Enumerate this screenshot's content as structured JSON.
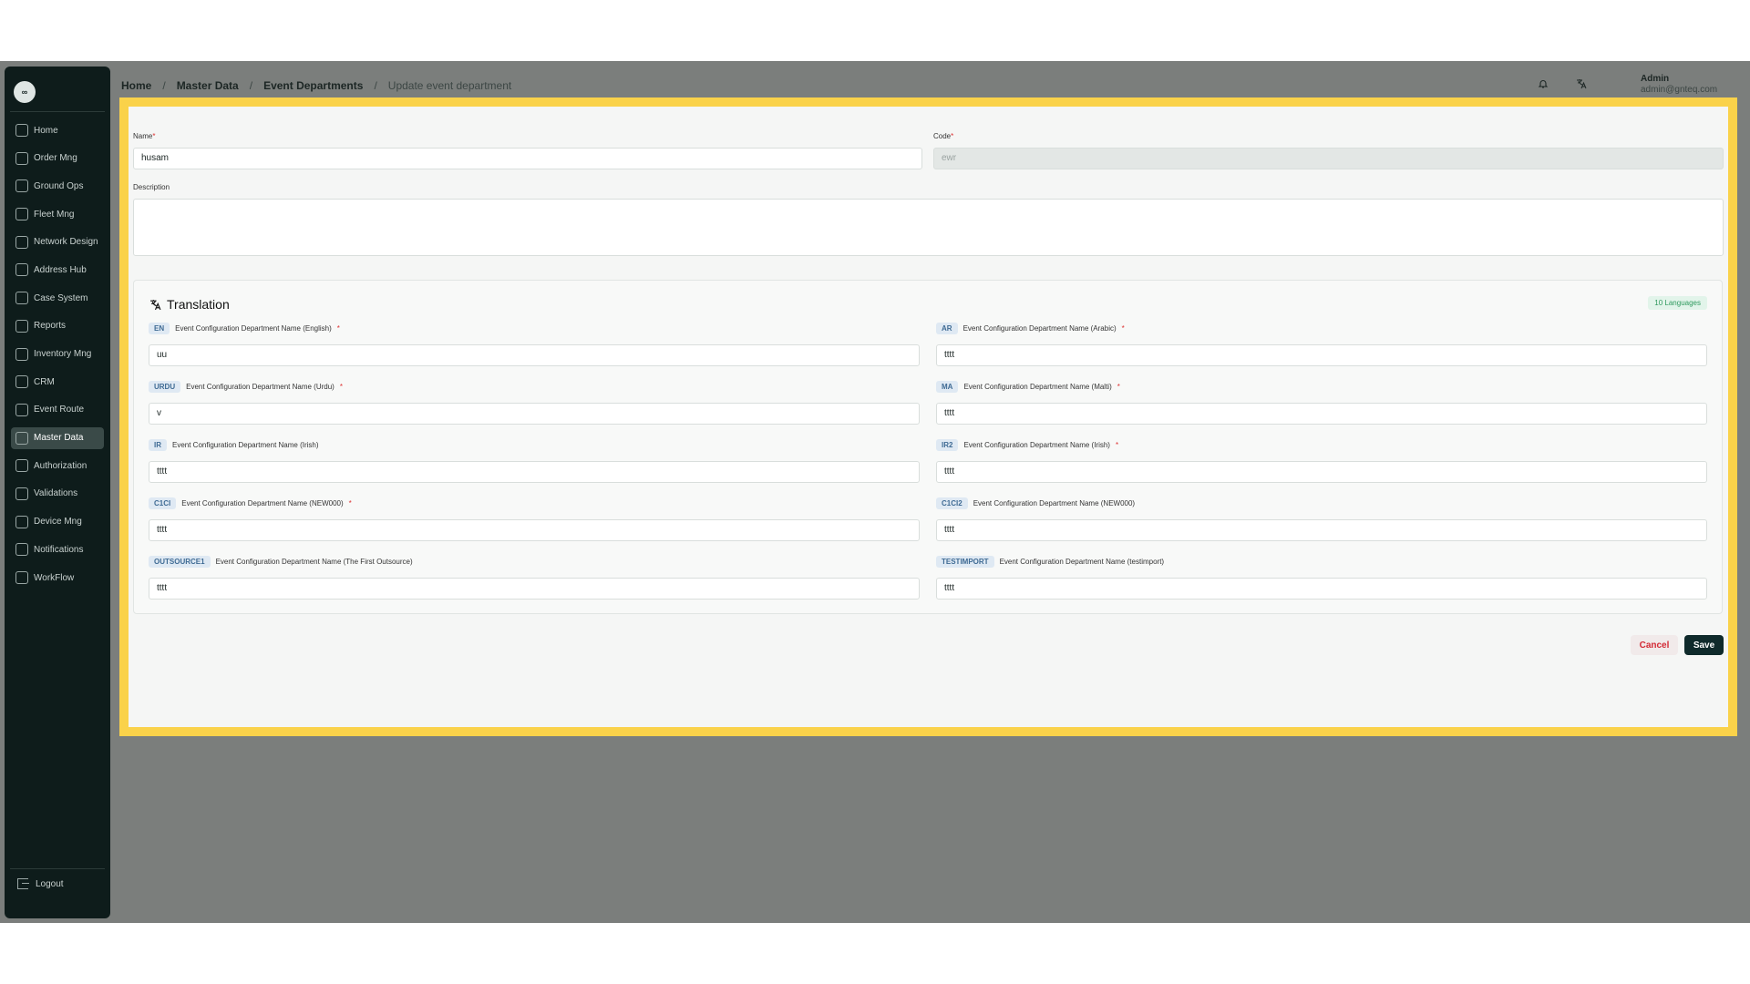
{
  "logo": {
    "text": "∞"
  },
  "sidebar": {
    "items": [
      {
        "label": "Home"
      },
      {
        "label": "Order Mng"
      },
      {
        "label": "Ground Ops"
      },
      {
        "label": "Fleet Mng"
      },
      {
        "label": "Network Design"
      },
      {
        "label": "Address Hub"
      },
      {
        "label": "Case System"
      },
      {
        "label": "Reports"
      },
      {
        "label": "Inventory Mng"
      },
      {
        "label": "CRM"
      },
      {
        "label": "Event Route"
      },
      {
        "label": "Master Data"
      },
      {
        "label": "Authorization"
      },
      {
        "label": "Validations"
      },
      {
        "label": "Device Mng"
      },
      {
        "label": "Notifications"
      },
      {
        "label": "WorkFlow"
      }
    ],
    "logout_label": "Logout"
  },
  "breadcrumb": {
    "home": "Home",
    "master_data": "Master Data",
    "event_departments": "Event Departments",
    "current": "Update event department",
    "sep": "/"
  },
  "header": {
    "bell_icon": "bell-icon",
    "translate_icon": "translate-icon",
    "user_name": "Admin",
    "user_email": "admin@gnteq.com"
  },
  "form": {
    "name_label": "Name",
    "name_value": "husam",
    "code_label": "Code",
    "code_value": "ewr",
    "description_label": "Description",
    "description_value": "",
    "required_mark": "*"
  },
  "translation": {
    "title": "Translation",
    "badge": "10 Languages",
    "fields": [
      {
        "code": "EN",
        "label": "Event Configuration Department Name (English)",
        "required": "*",
        "value": "uu"
      },
      {
        "code": "AR",
        "label": "Event Configuration Department Name (Arabic)",
        "required": "*",
        "value": "tttt"
      },
      {
        "code": "URDU",
        "label": "Event Configuration Department Name (Urdu)",
        "required": "*",
        "value": "v"
      },
      {
        "code": "MA",
        "label": "Event Configuration Department Name (Malti)",
        "required": "*",
        "value": "tttt"
      },
      {
        "code": "IR",
        "label": "Event Configuration Department Name (Irish)",
        "required": "",
        "value": "tttt"
      },
      {
        "code": "IR2",
        "label": "Event Configuration Department Name (Irish)",
        "required": "*",
        "value": "tttt"
      },
      {
        "code": "C1CI",
        "label": "Event Configuration Department Name (NEW000)",
        "required": "*",
        "value": "tttt"
      },
      {
        "code": "C1CI2",
        "label": "Event Configuration Department Name (NEW000)",
        "required": "",
        "value": "tttt"
      },
      {
        "code": "OUTSOURCE1",
        "label": "Event Configuration Department Name (The First Outsource)",
        "required": "",
        "value": "tttt"
      },
      {
        "code": "TESTIMPORT",
        "label": "Event Configuration Department Name (testimport)",
        "required": "",
        "value": "tttt"
      }
    ]
  },
  "actions": {
    "cancel_label": "Cancel",
    "save_label": "Save"
  },
  "colors": {
    "highlight": "#fad24a",
    "sidebar_bg": "#0e1c1b",
    "save_bg": "#0f2a2b",
    "cancel_text": "#d32a35",
    "required": "#dd3333",
    "badge_green": "#2f9a5e"
  }
}
